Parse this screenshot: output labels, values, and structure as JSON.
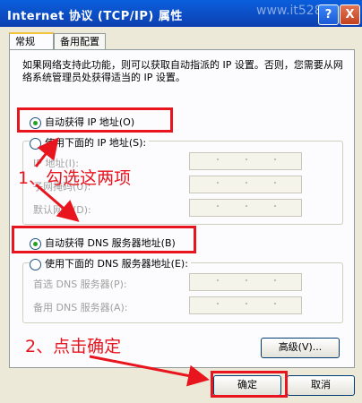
{
  "window": {
    "title": "Internet 协议 (TCP/IP) 属性",
    "watermark": "www.it528",
    "help_label": "?",
    "close_label": "X"
  },
  "tabs": [
    {
      "label": "常规",
      "active": true
    },
    {
      "label": "备用配置",
      "active": false
    }
  ],
  "description": "如果网络支持此功能，则可以获取自动指派的 IP 设置。否则，您需要从网络系统管理员处获得适当的 IP 设置。",
  "ip": {
    "auto_label": "自动获得 IP 地址(O)",
    "manual_label": "使用下面的 IP 地址(S):",
    "selected": "auto",
    "fields": [
      {
        "label": "IP 地址(I):",
        "value": ""
      },
      {
        "label": "子网掩码(U):",
        "value": ""
      },
      {
        "label": "默认网关(D):",
        "value": ""
      }
    ]
  },
  "dns": {
    "auto_label": "自动获得 DNS 服务器地址(B)",
    "manual_label": "使用下面的 DNS 服务器地址(E):",
    "selected": "auto",
    "fields": [
      {
        "label": "首选 DNS 服务器(P):",
        "value": ""
      },
      {
        "label": "备用 DNS 服务器(A):",
        "value": ""
      }
    ]
  },
  "buttons": {
    "advanced": "高级(V)...",
    "ok": "确定",
    "cancel": "取消"
  },
  "annotations": {
    "step1": "1、勾选这两项",
    "step2": "2、点击确定",
    "color": "#e8141e"
  }
}
